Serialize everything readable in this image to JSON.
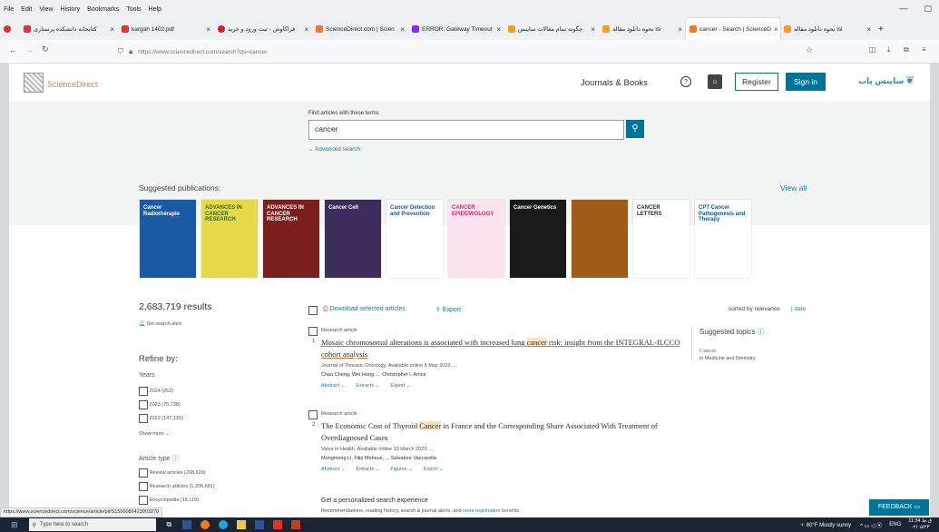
{
  "menubar": {
    "items": [
      "File",
      "Edit",
      "View",
      "History",
      "Bookmarks",
      "Tools",
      "Help"
    ]
  },
  "tabs": [
    {
      "label": "کتابخانه دانشکده پرستاری",
      "color": "#d33"
    },
    {
      "label": "kargah 1402.pdf",
      "color": "#d33"
    },
    {
      "label": "فراکاوش - ثبت ورود و خرید",
      "color": "#c22"
    },
    {
      "label": "ScienceDirect.com | Scien",
      "color": "#f47b20"
    },
    {
      "label": "ERROR: Gateway Timeout",
      "color": "#8a2be2"
    },
    {
      "label": "چگونه تمام مقالات ساینس",
      "color": "#f4a020"
    },
    {
      "label": "نحوه دانلود مقاله isi",
      "color": "#f4a020"
    },
    {
      "label": "cancer - Search | ScienceD",
      "color": "#f47b20"
    },
    {
      "label": "نحوه دانلود مقاله isi",
      "color": "#f4a020"
    }
  ],
  "tab_x": "×",
  "tab_new": "+",
  "nav": {
    "url": "https://www.sciencedirect.com/search?qs=cancer"
  },
  "header": {
    "brand": "ScienceDirect",
    "journals": "Journals & Books",
    "help": "?",
    "register": "Register",
    "signin": "Sign in",
    "partner": "ساینس یاب"
  },
  "search": {
    "label": "Find articles with these terms",
    "query": "cancer",
    "advanced": "Advanced search"
  },
  "suggested": {
    "title": "Suggested publications:",
    "view_all": "View all",
    "covers": [
      {
        "text": "Cancer Radiothérapie",
        "bg": "#1b5aa5",
        "fg": "#ffffff"
      },
      {
        "text": "ADVANCES IN CANCER RESEARCH",
        "bg": "#e6d94a",
        "fg": "#2a6b2a"
      },
      {
        "text": "ADVANCES IN CANCER RESEARCH",
        "bg": "#7a1e1e",
        "fg": "#ffffff"
      },
      {
        "text": "Cancer Cell",
        "bg": "#3b2d5c",
        "fg": "#ffffff"
      },
      {
        "text": "Cancer Detection and Prevention",
        "bg": "#ffffff",
        "fg": "#1b5aa5"
      },
      {
        "text": "CANCER EPIDEMIOLOGY",
        "bg": "#fce4ef",
        "fg": "#d12d6b"
      },
      {
        "text": "Cancer Genetics",
        "bg": "#1a1a1a",
        "fg": "#ffffff"
      },
      {
        "text": "",
        "bg": "#a05a1a",
        "fg": "#ffffff"
      },
      {
        "text": "CANCER LETTERS",
        "bg": "#ffffff",
        "fg": "#2a2a2a"
      },
      {
        "text": "CPT Cancer Pathogenesis and Therapy",
        "bg": "#ffffff",
        "fg": "#0a5aa8"
      }
    ]
  },
  "results": {
    "count": "2,683,719 results",
    "alert": "Set search alert",
    "download": "Download selected articles",
    "export": "Export",
    "sorted": "sorted by relevance",
    "date": "date"
  },
  "refine": {
    "title": "Refine by:",
    "years_label": "Years",
    "years": [
      "2024 (252)",
      "2023 (75,738)",
      "2022 (147,126)"
    ],
    "show_more": "Show more",
    "article_type": "Article type",
    "types": [
      "Review articles (208,629)",
      "Research articles (1,306,681)",
      "Encyclopedia (18,119)"
    ]
  },
  "articles": [
    {
      "type": "Research article",
      "num": "1",
      "title_parts": [
        "Mosaic chromosomal alterations is associated with increased lung ",
        "cancer",
        " risk: insight from the INTEGRAL-ILCCO cohort analysis"
      ],
      "journal": "Journal of Thoracic Oncology, Available online 5 May 2023, ...",
      "authors": "Chao Cheng, Wei Hong, ... Christopher I. Amos",
      "actions": [
        "Abstract",
        "Extracts",
        "Export"
      ]
    },
    {
      "type": "Research article",
      "num": "2",
      "title_parts": [
        "The Economic Cost of Thyroid ",
        "Cancer",
        " in France and the Corresponding Share Associated With Treatment of Overdiagnosed Cases"
      ],
      "journal": "Value in Health, Available online 13 March 2023, ...",
      "authors": "Mengmeng Li, Filip Meheus, ... Salvatore Vaccarella",
      "actions": [
        "Abstract",
        "Extracts",
        "Figures",
        "Export"
      ]
    }
  ],
  "topics": {
    "title": "Suggested topics",
    "name": "Cancer",
    "sub": "in Medicine and Dentistry"
  },
  "personalized": {
    "title": "Get a personalized search experience",
    "text": "Recommendations, reading history, search & journal alerts, and ",
    "link": "more registration benefits."
  },
  "feedback": "FEEDBACK",
  "statusbar_url": "https://www.sciencedirect.com/science/article/pii/S1556086423003270",
  "taskbar": {
    "search": "Type here to search",
    "weather": "80°F  Mostly sunny",
    "lang": "ENG",
    "time": "11:34 ق.ظ",
    "date": "۰۲/۰۵/۲۳"
  },
  "colors": {
    "accent": "#0c7dbb",
    "brand": "#f47b20",
    "signin": "#007398"
  }
}
